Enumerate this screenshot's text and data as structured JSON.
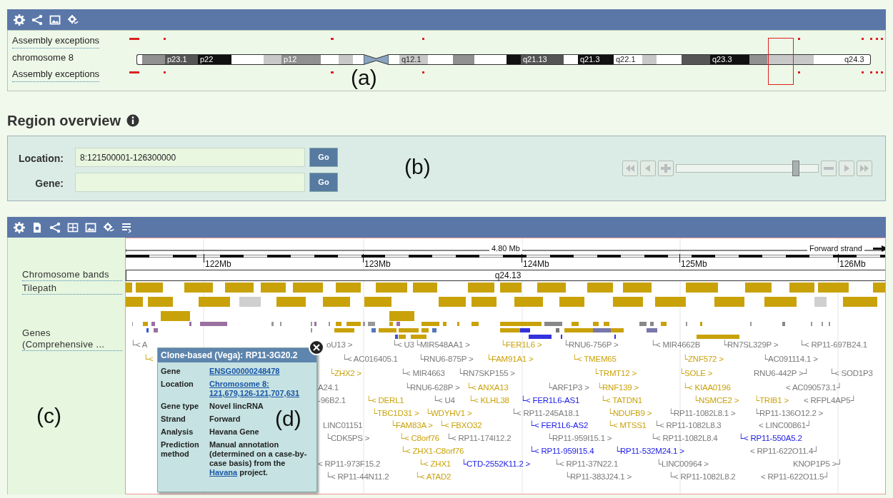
{
  "chromosome_panel": {
    "track_labels": [
      "Assembly exceptions",
      "chromosome 8",
      "Assembly exceptions"
    ],
    "bands": [
      {
        "kind": "gneg"
      },
      {
        "kind": "gpos50"
      },
      {
        "kind": "gpos75",
        "label": "p23.1"
      },
      {
        "kind": "gpos100",
        "label": "p22"
      },
      {
        "kind": "gneg"
      },
      {
        "kind": "gpos25"
      },
      {
        "kind": "gpos50",
        "label": "p12"
      },
      {
        "kind": "gneg"
      },
      {
        "kind": "gpos25"
      },
      {
        "kind": "gneg"
      },
      {
        "kind": "acen"
      },
      {
        "kind": "gneg"
      },
      {
        "kind": "gpos25",
        "label": "q12.1"
      },
      {
        "kind": "gneg"
      },
      {
        "kind": "gpos50"
      },
      {
        "kind": "gneg"
      },
      {
        "kind": "gpos100"
      },
      {
        "kind": "gpos75",
        "label": "q21.13"
      },
      {
        "kind": "gneg"
      },
      {
        "kind": "gpos100",
        "label": "q21.3"
      },
      {
        "kind": "gneg",
        "label": "q22.1"
      },
      {
        "kind": "gpos25"
      },
      {
        "kind": "gneg"
      },
      {
        "kind": "gpos75"
      },
      {
        "kind": "gpos100",
        "label": "q23.3"
      },
      {
        "kind": "gpos50"
      },
      {
        "kind": "gpos25"
      },
      {
        "kind": "gneg"
      },
      {
        "kind": "gneg",
        "label": "q24.3"
      }
    ],
    "annotation": "(a)"
  },
  "region_overview": {
    "title": "Region overview",
    "fields": [
      {
        "label": "Location:",
        "value": "8:121500001-126300000",
        "button": "Go"
      },
      {
        "label": "Gene:",
        "button": "Go"
      }
    ],
    "annotation": "(b)",
    "zoom_slider": {
      "level": 0.86
    }
  },
  "detail_panel": {
    "track_labels": [
      "Chromosome bands",
      "Tilepath",
      "Genes (Comprehensive ..."
    ],
    "scale": {
      "span": "4.80 Mb",
      "strand": "Forward strand"
    },
    "ticks": [
      "122Mb",
      "123Mb",
      "124Mb",
      "125Mb",
      "126Mb"
    ],
    "band": "q24.13",
    "gene_rows": [
      [
        {
          "name": "└< A",
          "color": "#7a7a7a"
        },
        {
          "name": "oU13 >",
          "color": "#7a7a7a"
        },
        {
          "name": "└< U3",
          "color": "#7a7a7a"
        },
        {
          "name": "└MIR548AA1 >",
          "color": "#7a7a7a"
        },
        {
          "name": "└FER1L6 >",
          "color": "#c9a20a"
        },
        {
          "name": "└RNU6-756P >",
          "color": "#7a7a7a"
        },
        {
          "name": "└< MIR4662B",
          "color": "#7a7a7a"
        },
        {
          "name": "└RN7SL329P >",
          "color": "#7a7a7a"
        },
        {
          "name": "└< RP11-697B24.1",
          "color": "#7a7a7a"
        }
      ],
      [
        {
          "name": "└<",
          "color": "#c9a20a"
        },
        {
          "name": "└< AC016405.1",
          "color": "#7a7a7a"
        },
        {
          "name": "└RNU6-875P >",
          "color": "#7a7a7a"
        },
        {
          "name": "└FAM91A1 >",
          "color": "#c9a20a"
        },
        {
          "name": "└< TMEM65",
          "color": "#c9a20a"
        },
        {
          "name": "└ZNF572 >",
          "color": "#c9a20a"
        },
        {
          "name": "└AC091114.1 >",
          "color": "#7a7a7a"
        }
      ],
      [
        {
          "name": "└ZHX2 >",
          "color": "#c9a20a"
        },
        {
          "name": "└< MIR4663",
          "color": "#7a7a7a"
        },
        {
          "name": "└RN7SKP155 >",
          "color": "#7a7a7a"
        },
        {
          "name": "└TRMT12 >",
          "color": "#c9a20a"
        },
        {
          "name": "└SOLE >",
          "color": "#c9a20a"
        },
        {
          "name": "RNU6-442P >┘",
          "color": "#7a7a7a"
        },
        {
          "name": "└< SOD1P3",
          "color": "#7a7a7a"
        }
      ],
      [
        {
          "name": "A24.1",
          "color": "#7a7a7a"
        },
        {
          "name": "└RNU6-628P >",
          "color": "#7a7a7a"
        },
        {
          "name": "└< ANXA13",
          "color": "#c9a20a"
        },
        {
          "name": "└ARF1P3 >",
          "color": "#7a7a7a"
        },
        {
          "name": "└RNF139 >",
          "color": "#c9a20a"
        },
        {
          "name": "└< KIAA0196",
          "color": "#c9a20a"
        },
        {
          "name": "< AC090573.1┘",
          "color": "#7a7a7a"
        }
      ],
      [
        {
          "name": "-96B2.1",
          "color": "#7a7a7a"
        },
        {
          "name": "└< DERL1",
          "color": "#c9a20a"
        },
        {
          "name": "└< U4",
          "color": "#7a7a7a"
        },
        {
          "name": "└< KLHL38",
          "color": "#c9a20a"
        },
        {
          "name": "└< FER1L6-AS1",
          "color": "#1a1ae6"
        },
        {
          "name": "└< TATDN1",
          "color": "#c9a20a"
        },
        {
          "name": "└NSMCE2 >",
          "color": "#c9a20a"
        },
        {
          "name": "└TRIB1 >",
          "color": "#c9a20a"
        },
        {
          "name": "< RFPL4AP5┘",
          "color": "#7a7a7a"
        }
      ],
      [
        {
          "name": "└TBC1D31 >",
          "color": "#c9a20a"
        },
        {
          "name": "└WDYHV1 >",
          "color": "#c9a20a"
        },
        {
          "name": "└< RP11-245A18.1",
          "color": "#7a7a7a"
        },
        {
          "name": "└NDUFB9 >",
          "color": "#c9a20a"
        },
        {
          "name": "└RP11-1082L8.1 >",
          "color": "#7a7a7a"
        },
        {
          "name": "└RP11-136O12.2 >",
          "color": "#7a7a7a"
        }
      ],
      [
        {
          "name": "LINC01151",
          "color": "#7a7a7a"
        },
        {
          "name": "└FAM83A >",
          "color": "#c9a20a"
        },
        {
          "name": "└< FBXO32",
          "color": "#c9a20a"
        },
        {
          "name": "└< FER1L6-AS2",
          "color": "#1a1ae6"
        },
        {
          "name": "└< MTSS1",
          "color": "#c9a20a"
        },
        {
          "name": "└< RP11-1082L8.3",
          "color": "#7a7a7a"
        },
        {
          "name": "< LINC00861┘",
          "color": "#7a7a7a"
        }
      ],
      [
        {
          "name": "└CDK5PS >",
          "color": "#7a7a7a"
        },
        {
          "name": "└< C8orf76",
          "color": "#c9a20a"
        },
        {
          "name": "└< RP11-174I12.2",
          "color": "#7a7a7a"
        },
        {
          "name": "└RP11-959I15.1 >",
          "color": "#7a7a7a"
        },
        {
          "name": "└< RP11-1082L8.4",
          "color": "#7a7a7a"
        },
        {
          "name": "└< RP11-550A5.2",
          "color": "#1a1ae6"
        }
      ],
      [
        {
          "name": "└< ZHX1-C8orf76",
          "color": "#c9a20a"
        },
        {
          "name": "└< RP11-959I15.4",
          "color": "#1a1ae6"
        },
        {
          "name": "└RP11-532M24.1 >",
          "color": "#1a1ae6"
        },
        {
          "name": "< RP11-622O11.4┘",
          "color": "#7a7a7a"
        }
      ],
      [
        {
          "name": "< RP11-973F15.2",
          "color": "#7a7a7a"
        },
        {
          "name": "└< ZHX1",
          "color": "#c9a20a"
        },
        {
          "name": "└CTD-2552K11.2 >",
          "color": "#1a1ae6"
        },
        {
          "name": "└< RP11-37N22.1",
          "color": "#7a7a7a"
        },
        {
          "name": "└LINC00964 >",
          "color": "#7a7a7a"
        },
        {
          "name": "KNOP1P5 >┘",
          "color": "#7a7a7a"
        }
      ],
      [
        {
          "name": "└< RP11-44N11.2",
          "color": "#7a7a7a"
        },
        {
          "name": "└< ATAD2",
          "color": "#c9a20a"
        },
        {
          "name": "└RP11-383J24.1 >",
          "color": "#7a7a7a"
        },
        {
          "name": "└< RP11-1082L8.2",
          "color": "#7a7a7a"
        },
        {
          "name": "< RP11-622O11.5┘",
          "color": "#7a7a7a"
        }
      ]
    ],
    "annotations": [
      "(c)",
      "(d)"
    ],
    "popup": {
      "title": "Clone-based (Vega): RP11-3G20.2",
      "rows": [
        {
          "label": "Gene",
          "link": "ENSG00000248478"
        },
        {
          "label": "Location",
          "link": "Chromosome 8: 121,679,126-121,707,631"
        },
        {
          "label": "Gene type",
          "value": "Novel lincRNA"
        },
        {
          "label": "Strand",
          "value": "Forward"
        },
        {
          "label": "Analysis",
          "value": "Havana Gene"
        },
        {
          "label": "Prediction method",
          "value": "Manual annotation (determined on a case-by-case basis) from the",
          "link": "Havana",
          "after": "project."
        }
      ]
    }
  }
}
